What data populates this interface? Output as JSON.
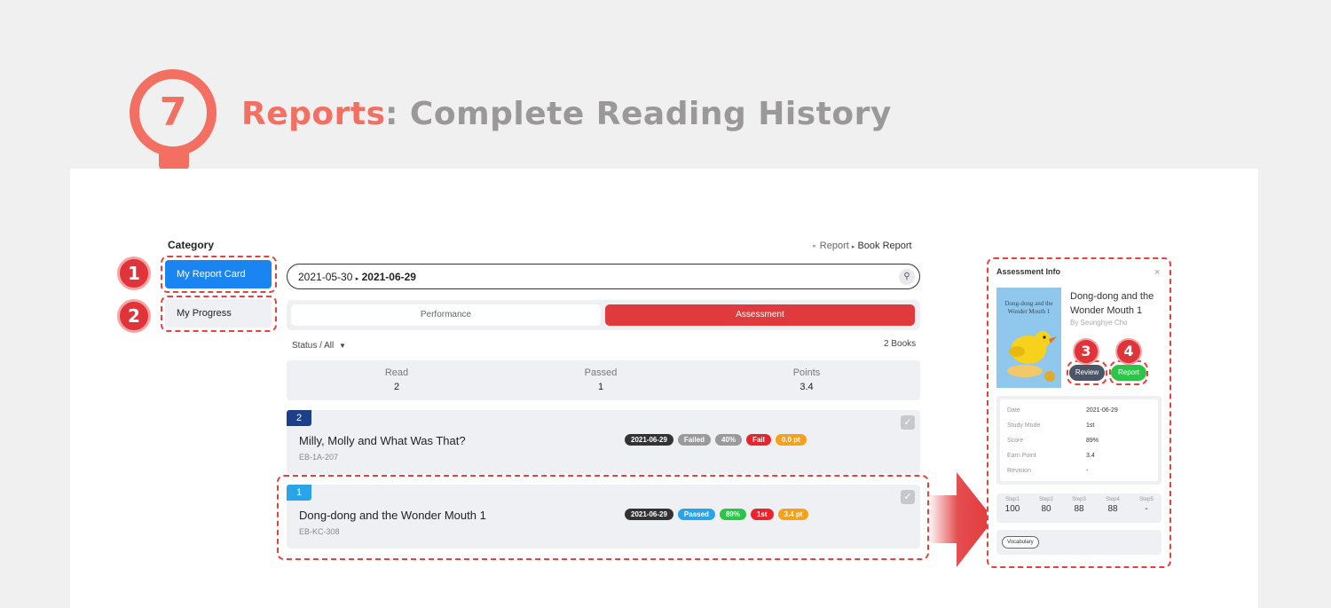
{
  "header": {
    "number": "7",
    "title": "Reports",
    "subtitle": ": Complete Reading History"
  },
  "sidebar": {
    "title": "Category",
    "items": [
      {
        "label": "My Report Card",
        "active": true
      },
      {
        "label": "My Progress",
        "active": false
      }
    ]
  },
  "callouts": [
    "1",
    "2",
    "3",
    "4"
  ],
  "breadcrumb": {
    "items": [
      "Report",
      "Book Report"
    ]
  },
  "date_range": {
    "start": "2021-05-30",
    "end": "2021-06-29"
  },
  "tabs": [
    {
      "label": "Performance",
      "active": false
    },
    {
      "label": "Assessment",
      "active": true
    }
  ],
  "filter": {
    "label": "Status / All",
    "count": "2 Books"
  },
  "summary": [
    {
      "label": "Read",
      "value": "2"
    },
    {
      "label": "Passed",
      "value": "1"
    },
    {
      "label": "Points",
      "value": "3.4"
    }
  ],
  "rows": [
    {
      "no": "2",
      "title": "Milly, Molly and What Was That?",
      "code": "EB-1A-207",
      "date": "2021-06-29",
      "status": "Failed",
      "score": "40%",
      "attempt": "Fail",
      "points": "0.0 pt"
    },
    {
      "no": "1",
      "title": "Dong-dong and the Wonder Mouth 1",
      "code": "EB-KC-308",
      "date": "2021-06-29",
      "status": "Passed",
      "score": "89%",
      "attempt": "1st",
      "points": "3.4 pt"
    }
  ],
  "info": {
    "title": "Assessment Info",
    "close": "×",
    "cover_text": "Dong-dong and the Wonder Mouth 1",
    "book_title": "Dong-dong and the Wonder Mouth 1",
    "author": "By Seunghye Cho",
    "review_label": "Review",
    "report_label": "Report",
    "details": [
      {
        "label": "Date",
        "value": "2021-06-29"
      },
      {
        "label": "Study Mode",
        "value": "1st"
      },
      {
        "label": "Score",
        "value": "89%"
      },
      {
        "label": "Earn Point",
        "value": "3.4"
      },
      {
        "label": "Revision",
        "value": "-"
      }
    ],
    "steps": [
      {
        "label": "Step1",
        "value": "100"
      },
      {
        "label": "Step2",
        "value": "80"
      },
      {
        "label": "Step3",
        "value": "88"
      },
      {
        "label": "Step4",
        "value": "88"
      },
      {
        "label": "Step5",
        "value": "-"
      }
    ],
    "vocab_label": "Vocabulary"
  },
  "colors": {
    "accent": "#f26f62",
    "primary": "#1a85f0",
    "danger": "#e03a3c",
    "callout": "#e0343a"
  }
}
